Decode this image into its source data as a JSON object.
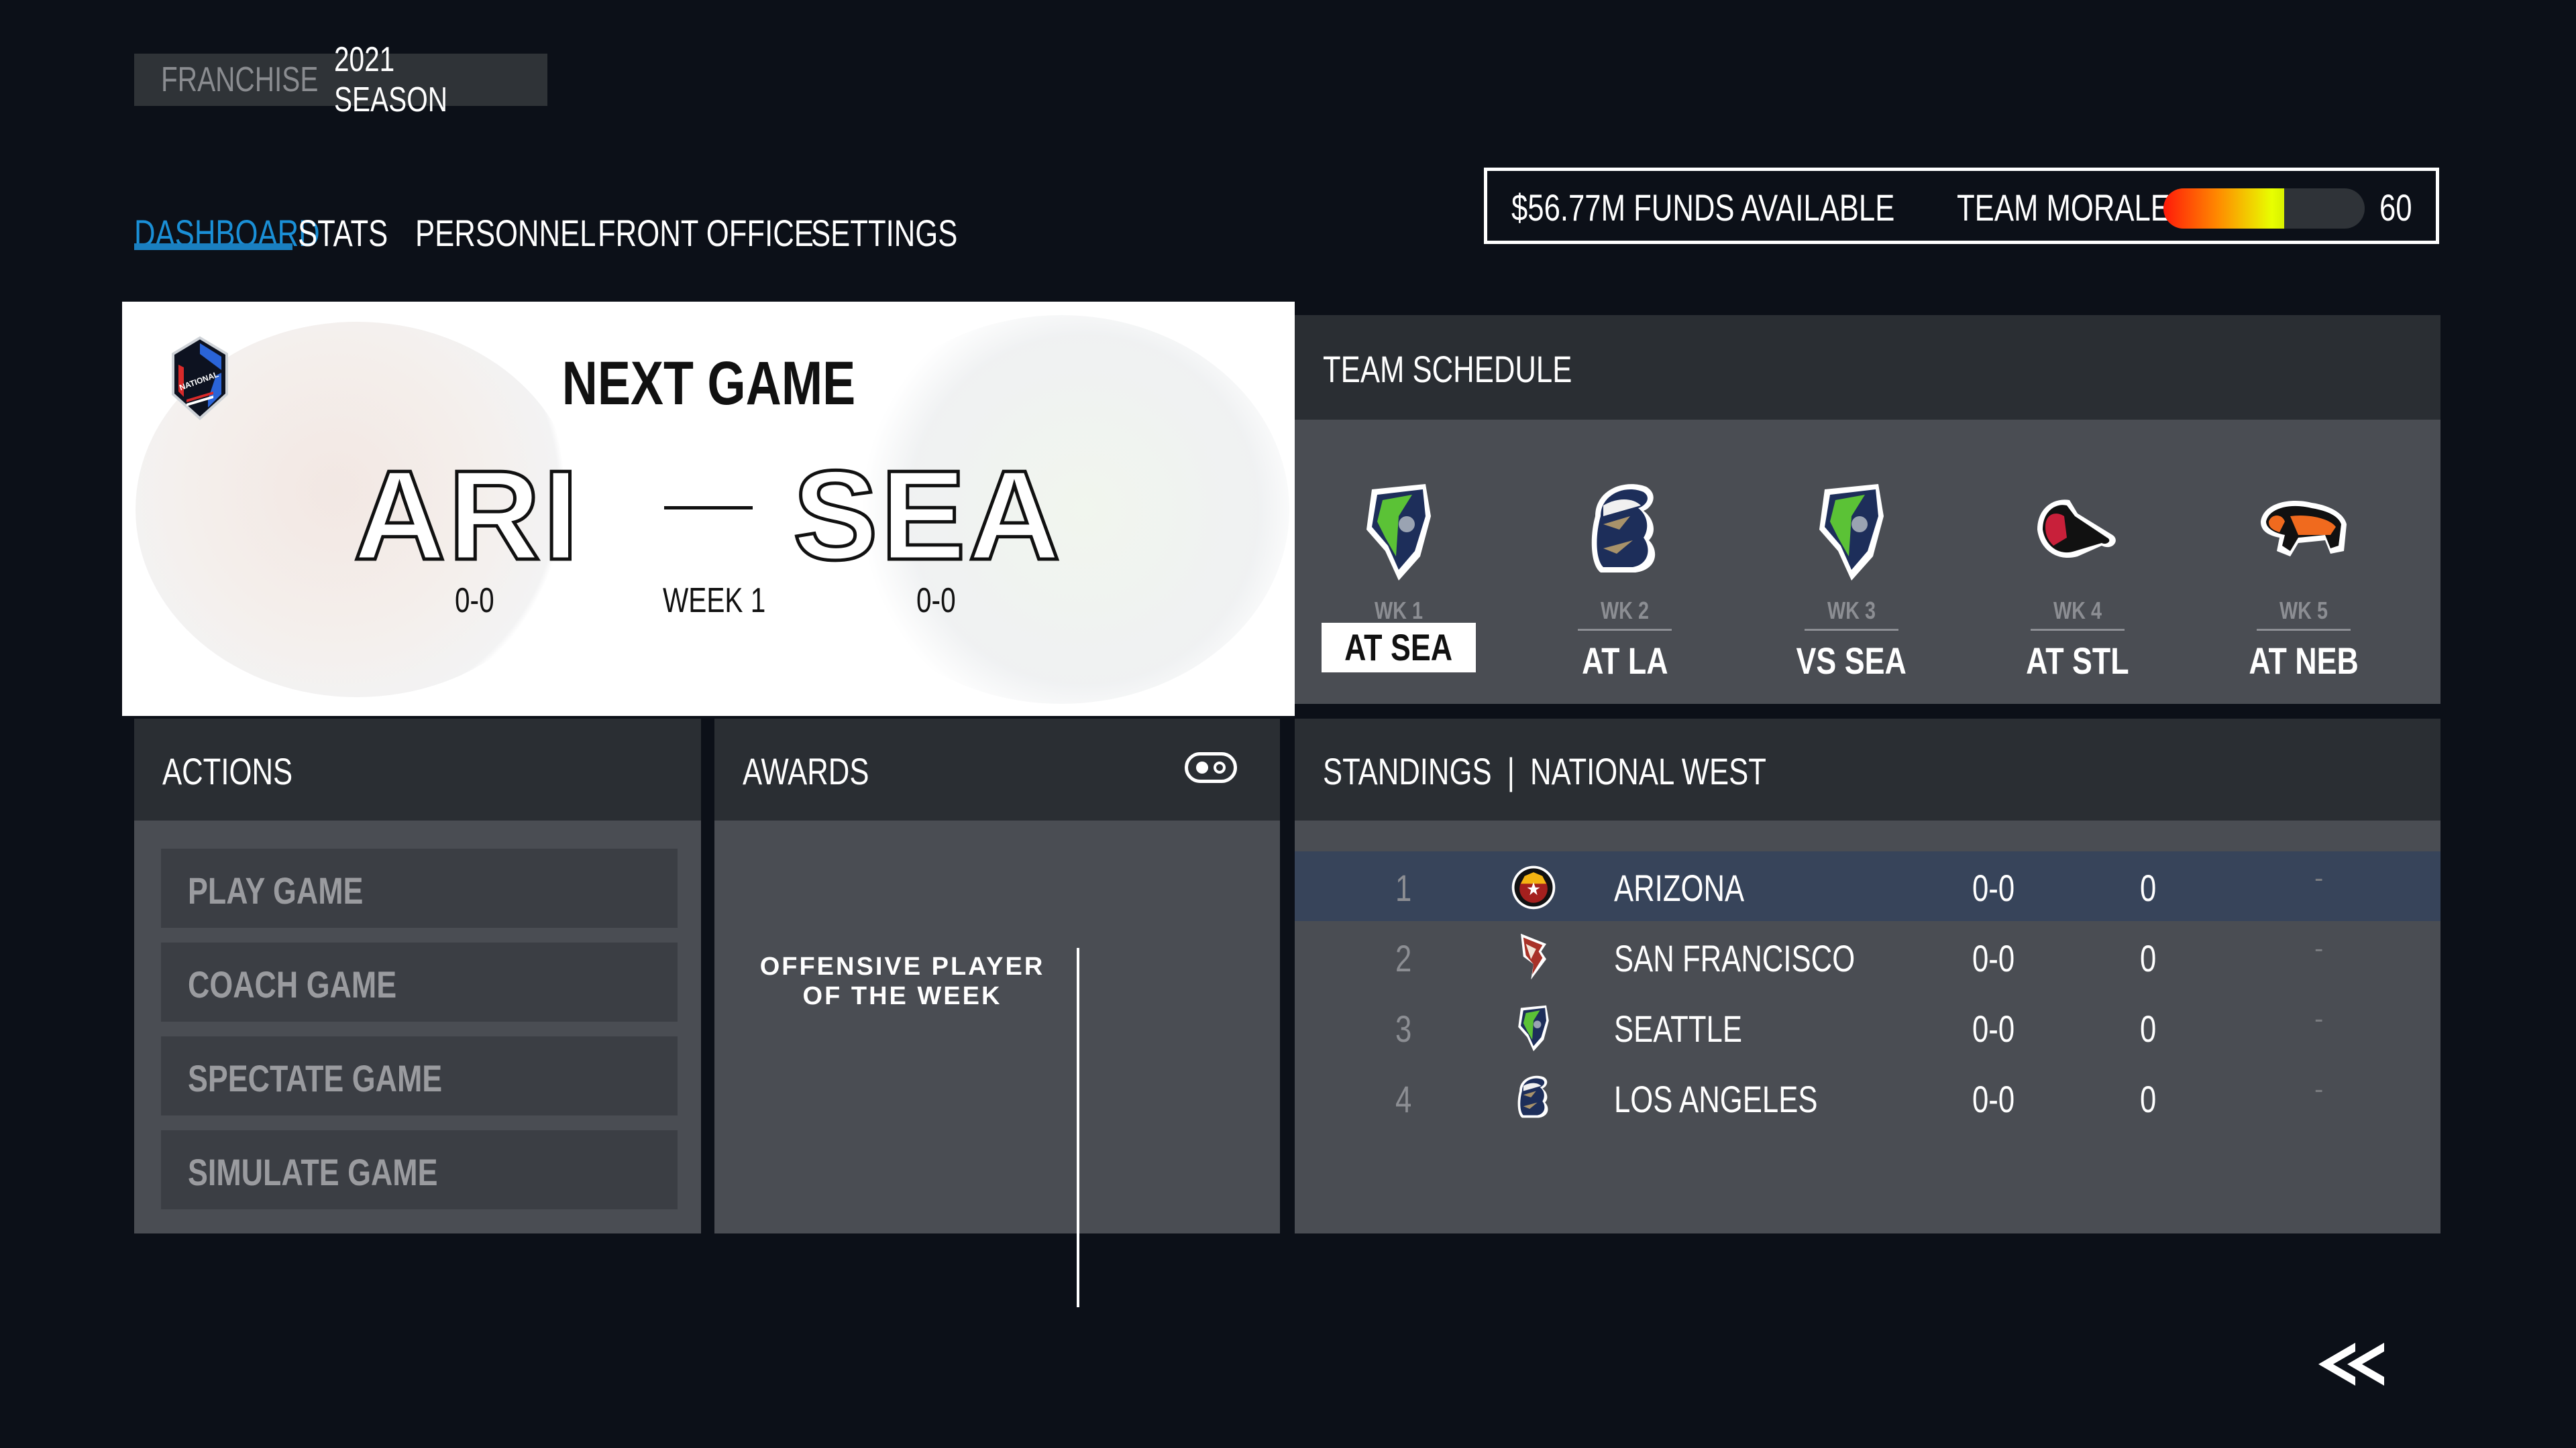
{
  "header": {
    "mode_label": "FRANCHISE",
    "season_label": "2021 SEASON"
  },
  "nav": {
    "items": [
      {
        "label": "DASHBOARD",
        "active": true
      },
      {
        "label": "STATS",
        "active": false
      },
      {
        "label": "PERSONNEL",
        "active": false
      },
      {
        "label": "FRONT OFFICE",
        "active": false
      },
      {
        "label": "SETTINGS",
        "active": false
      }
    ],
    "accent_color": "#1a8fd6"
  },
  "status": {
    "funds_text": "$56.77M FUNDS AVAILABLE",
    "morale_label": "TEAM MORALE",
    "morale_value": "60",
    "morale_fraction": 0.6
  },
  "next_game": {
    "title": "NEXT GAME",
    "league_badge": "NATIONAL",
    "away_team": "ARI",
    "home_team": "SEA",
    "away_record": "0-0",
    "home_record": "0-0",
    "week_label": "WEEK 1",
    "separator": "—"
  },
  "schedule": {
    "title": "TEAM SCHEDULE",
    "games": [
      {
        "week": "WK 1",
        "opponent": "AT SEA",
        "logo": "seattle-logo-icon",
        "current": true
      },
      {
        "week": "WK 2",
        "opponent": "AT LA",
        "logo": "los-angeles-logo-icon",
        "current": false
      },
      {
        "week": "WK 3",
        "opponent": "VS SEA",
        "logo": "seattle-logo-icon",
        "current": false
      },
      {
        "week": "WK 4",
        "opponent": "AT STL",
        "logo": "st-louis-logo-icon",
        "current": false
      },
      {
        "week": "WK 5",
        "opponent": "AT NEB",
        "logo": "nebraska-logo-icon",
        "current": false
      }
    ]
  },
  "actions": {
    "title": "ACTIONS",
    "buttons": [
      "PLAY GAME",
      "COACH GAME",
      "SPECTATE GAME",
      "SIMULATE GAME"
    ]
  },
  "awards": {
    "title": "AWARDS",
    "toggle_icon": "toggle-icon",
    "award_title_line1": "OFFENSIVE PLAYER",
    "award_title_line2": "OF THE WEEK"
  },
  "standings": {
    "title": "STANDINGS",
    "division": "NATIONAL WEST",
    "separator": "|",
    "rows": [
      {
        "rank": "1",
        "team": "ARIZONA",
        "record": "0-0",
        "points": "0",
        "gb": "-",
        "logo": "arizona-logo-icon",
        "highlight": true
      },
      {
        "rank": "2",
        "team": "SAN FRANCISCO",
        "record": "0-0",
        "points": "0",
        "gb": "-",
        "logo": "san-francisco-logo-icon",
        "highlight": false
      },
      {
        "rank": "3",
        "team": "SEATTLE",
        "record": "0-0",
        "points": "0",
        "gb": "-",
        "logo": "seattle-logo-icon",
        "highlight": false
      },
      {
        "rank": "4",
        "team": "LOS ANGELES",
        "record": "0-0",
        "points": "0",
        "gb": "-",
        "logo": "los-angeles-logo-icon",
        "highlight": false
      }
    ]
  },
  "footer": {
    "back_icon": "double-chevron-left-icon"
  }
}
